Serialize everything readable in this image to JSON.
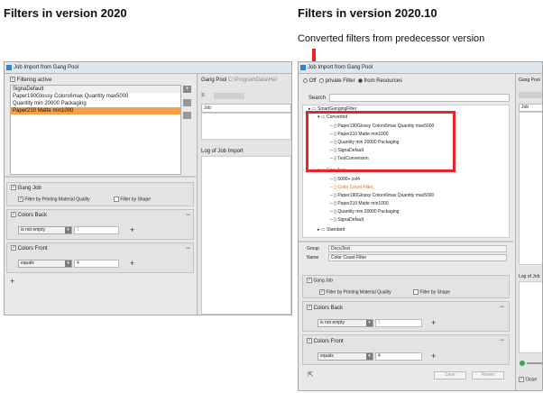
{
  "headings": {
    "left": "Filters in version 2020",
    "right": "Filters in version 2020.10",
    "right_caption": "Converted filters from predecessor version"
  },
  "colors": {
    "highlight": "#f7a04a",
    "annotation": "#e8242a",
    "orange_text": "#e06a1a"
  },
  "left_window": {
    "title": "Job Import from Gang Pool",
    "filtering_active": "Filtering active",
    "filters": [
      "SignaDefault",
      "Paper190Glossy Colors6max Quantity max5000",
      "Quantity min 20000 Packaging",
      "Paper210 Matte min1000"
    ],
    "selected_index": 3,
    "gang_pool_label": "Gang Pool",
    "gang_pool_path": "C:\\ProgramData\\Hei",
    "sort_label": "≡",
    "job_column": "Job",
    "log_label": "Log of Job Import",
    "gang_job": "Gang Job",
    "filter_by_material": "Filter by Printing Material Quality",
    "filter_by_shape": "Filter by Shape",
    "colors_back": "Colors Back",
    "back_condition": "is not empty",
    "back_value": "1",
    "colors_front": "Colors Front",
    "front_condition": "equals",
    "front_value": "4",
    "add_symbol": "+",
    "remove_symbol": "−"
  },
  "right_window": {
    "title": "Job Import from Gang Pool",
    "radio_off": "Off",
    "radio_private": "private Filter",
    "radio_resources": "from Resources",
    "search_label": "Search",
    "tree_root": "SmartGangingFilter",
    "converted_folder": "Converted",
    "converted_items": [
      "Paper190Glossy Colors6max Quantity max5000",
      "Paper210 Matte min1000",
      "Quantity min 20000 Packaging",
      "SignaDefault",
      "TestConversion"
    ],
    "docutest_folder": "DocuTest",
    "docutest_items": [
      "5000+ col4",
      "Color Count Filter",
      "Paper190Glossy Colors6max Quantity max5000",
      "Paper210 Matte min1000",
      "Quantity min 20000 Packaging",
      "SignaDefault"
    ],
    "standard_folder": "Standard",
    "group_label": "Group",
    "group_value": "DocuTest",
    "name_label": "Name",
    "name_value": "Color Count Filter",
    "gang_pool_label": "Gang Pool",
    "job_column": "Job",
    "log_label": "Log of Job",
    "gang_job": "Gang Job",
    "filter_by_material": "Filter by Printing Material Quality",
    "filter_by_shape": "Filter by Shape",
    "colors_back": "Colors Back",
    "back_condition": "is not empty",
    "back_value": "1",
    "colors_front": "Colors Front",
    "front_condition": "equals",
    "front_value": "4",
    "save_button": "Save",
    "revert_button": "Revert",
    "close_label": "Close",
    "add_symbol": "+",
    "remove_symbol": "−"
  }
}
